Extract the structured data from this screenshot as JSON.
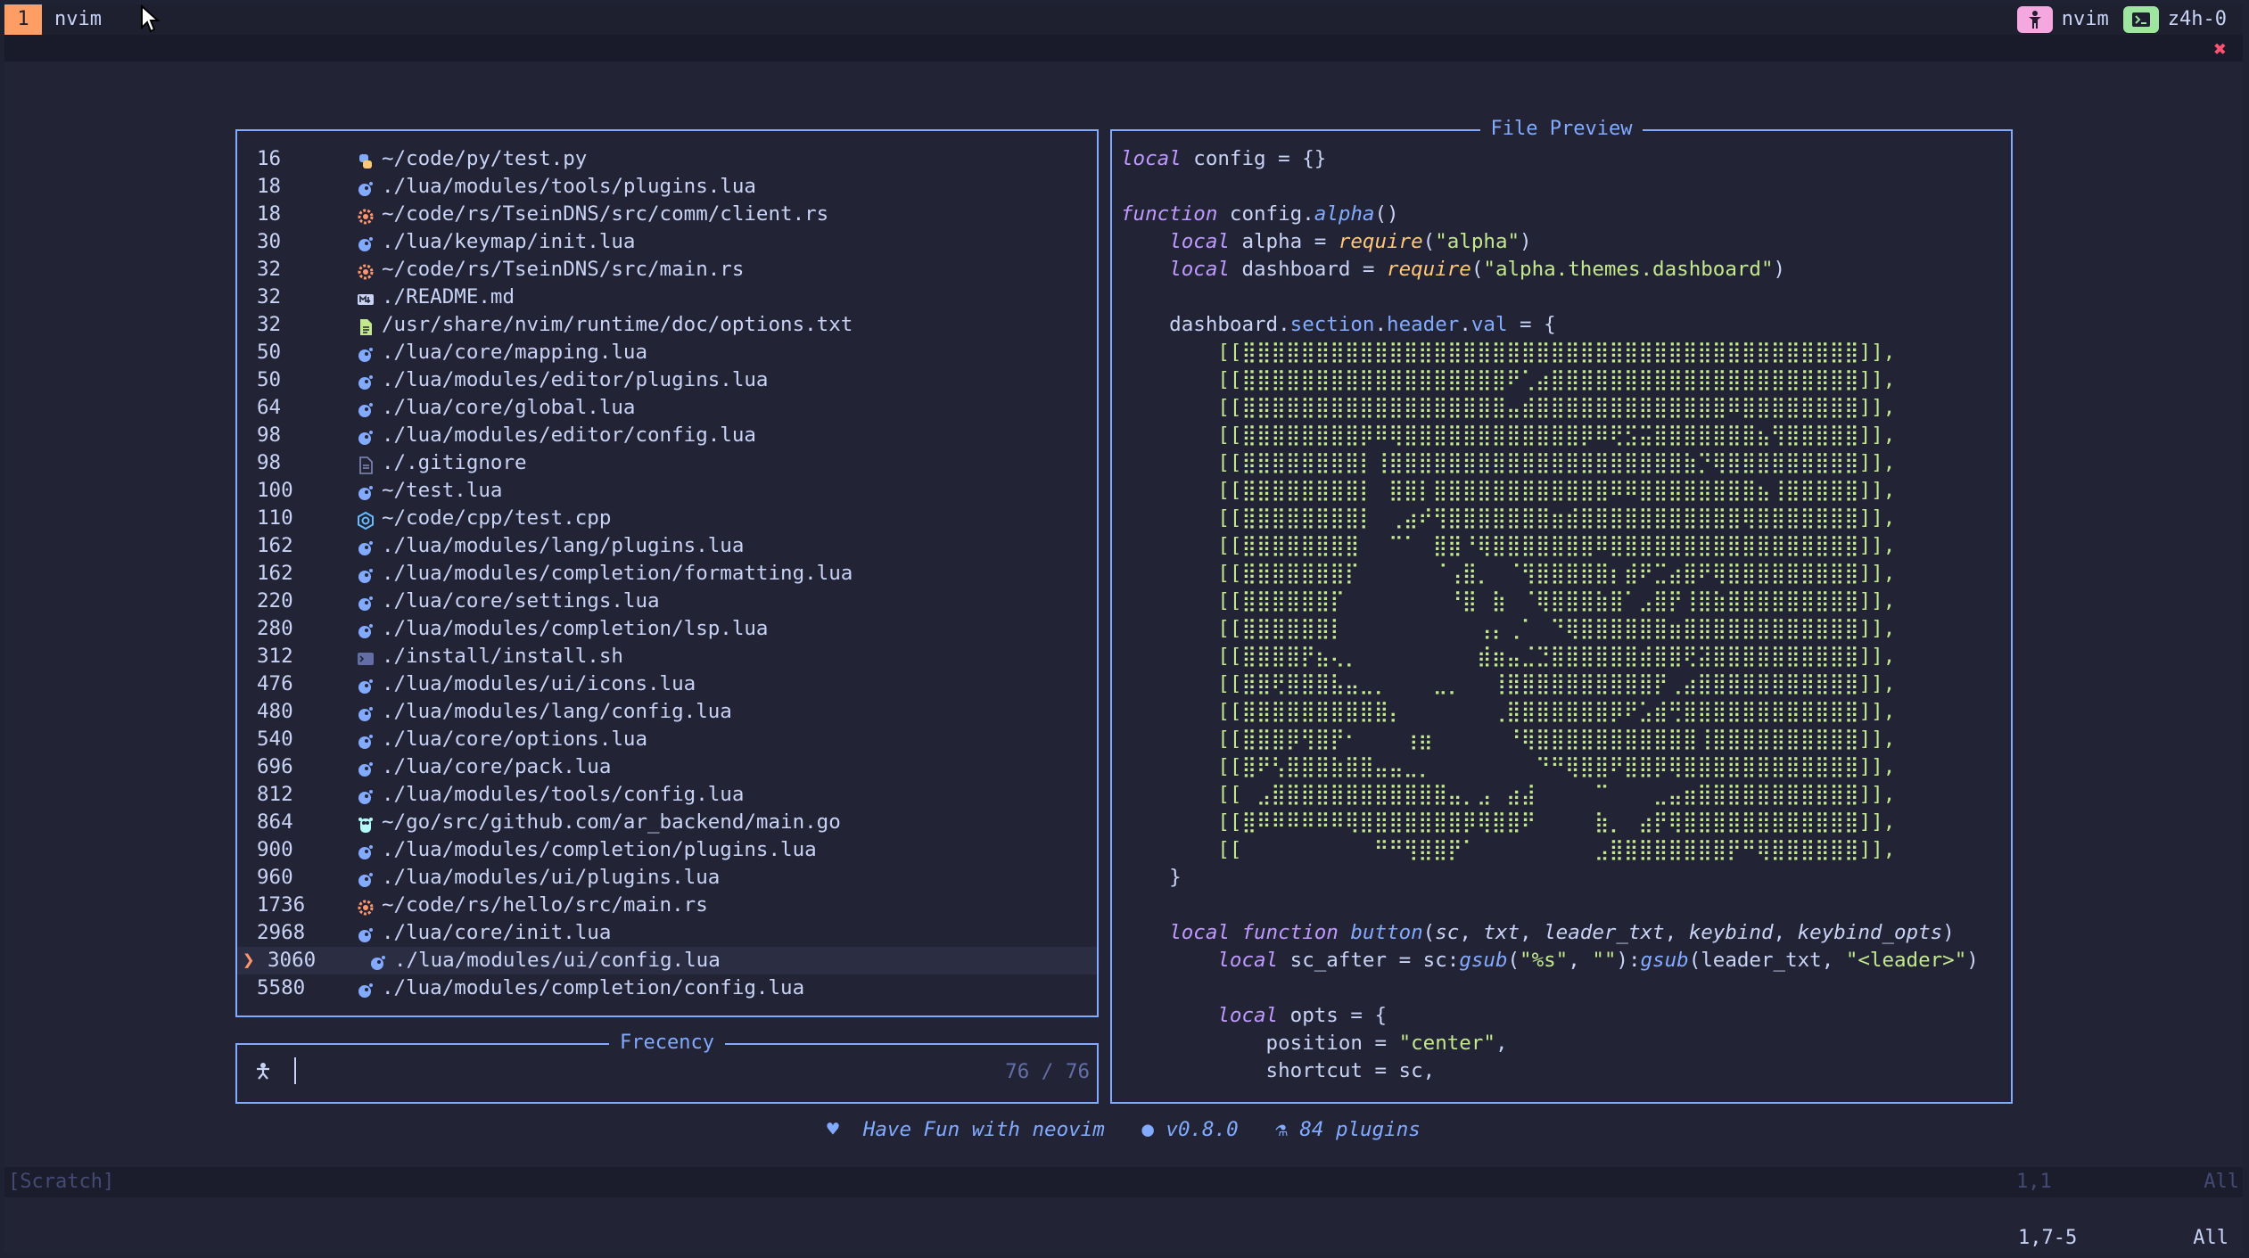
{
  "tmux": {
    "window_number": "1",
    "window_name": "nvim",
    "right_items": [
      {
        "icon": "person-icon",
        "label": "nvim",
        "color": "#f5a8e0"
      },
      {
        "icon": "terminal-icon",
        "label": "z4h-0",
        "color": "#9ee6a0"
      }
    ]
  },
  "picker": {
    "results_rows": [
      {
        "score": "16",
        "icon": "python-icon",
        "icon_color": "#ffc777",
        "path": "~/code/py/test.py"
      },
      {
        "score": "18",
        "icon": "lua-icon",
        "icon_color": "#82aaff",
        "path": "./lua/modules/tools/plugins.lua"
      },
      {
        "score": "18",
        "icon": "rust-icon",
        "icon_color": "#ff966c",
        "path": "~/code/rs/TseinDNS/src/comm/client.rs"
      },
      {
        "score": "30",
        "icon": "lua-icon",
        "icon_color": "#82aaff",
        "path": "./lua/keymap/init.lua"
      },
      {
        "score": "32",
        "icon": "rust-icon",
        "icon_color": "#ff966c",
        "path": "~/code/rs/TseinDNS/src/main.rs"
      },
      {
        "score": "32",
        "icon": "markdown-icon",
        "icon_color": "#c8d3f5",
        "path": "./README.md"
      },
      {
        "score": "32",
        "icon": "text-file-icon",
        "icon_color": "#c3e88d",
        "path": "/usr/share/nvim/runtime/doc/options.txt"
      },
      {
        "score": "50",
        "icon": "lua-icon",
        "icon_color": "#82aaff",
        "path": "./lua/core/mapping.lua"
      },
      {
        "score": "50",
        "icon": "lua-icon",
        "icon_color": "#82aaff",
        "path": "./lua/modules/editor/plugins.lua"
      },
      {
        "score": "64",
        "icon": "lua-icon",
        "icon_color": "#82aaff",
        "path": "./lua/core/global.lua"
      },
      {
        "score": "98",
        "icon": "lua-icon",
        "icon_color": "#82aaff",
        "path": "./lua/modules/editor/config.lua"
      },
      {
        "score": "98",
        "icon": "file-icon",
        "icon_color": "#828bb8",
        "path": "./.gitignore"
      },
      {
        "score": "100",
        "icon": "lua-icon",
        "icon_color": "#82aaff",
        "path": "~/test.lua"
      },
      {
        "score": "110",
        "icon": "cpp-icon",
        "icon_color": "#65bcff",
        "path": "~/code/cpp/test.cpp"
      },
      {
        "score": "162",
        "icon": "lua-icon",
        "icon_color": "#82aaff",
        "path": "./lua/modules/lang/plugins.lua"
      },
      {
        "score": "162",
        "icon": "lua-icon",
        "icon_color": "#82aaff",
        "path": "./lua/modules/completion/formatting.lua"
      },
      {
        "score": "220",
        "icon": "lua-icon",
        "icon_color": "#82aaff",
        "path": "./lua/core/settings.lua"
      },
      {
        "score": "280",
        "icon": "lua-icon",
        "icon_color": "#82aaff",
        "path": "./lua/modules/completion/lsp.lua"
      },
      {
        "score": "312",
        "icon": "shell-icon",
        "icon_color": "#636da6",
        "path": "./install/install.sh"
      },
      {
        "score": "476",
        "icon": "lua-icon",
        "icon_color": "#82aaff",
        "path": "./lua/modules/ui/icons.lua"
      },
      {
        "score": "480",
        "icon": "lua-icon",
        "icon_color": "#82aaff",
        "path": "./lua/modules/lang/config.lua"
      },
      {
        "score": "540",
        "icon": "lua-icon",
        "icon_color": "#82aaff",
        "path": "./lua/core/options.lua"
      },
      {
        "score": "696",
        "icon": "lua-icon",
        "icon_color": "#82aaff",
        "path": "./lua/core/pack.lua"
      },
      {
        "score": "812",
        "icon": "lua-icon",
        "icon_color": "#82aaff",
        "path": "./lua/modules/tools/config.lua"
      },
      {
        "score": "864",
        "icon": "go-icon",
        "icon_color": "#b4f9f8",
        "path": "~/go/src/github.com/ar_backend/main.go"
      },
      {
        "score": "900",
        "icon": "lua-icon",
        "icon_color": "#82aaff",
        "path": "./lua/modules/completion/plugins.lua"
      },
      {
        "score": "960",
        "icon": "lua-icon",
        "icon_color": "#82aaff",
        "path": "./lua/modules/ui/plugins.lua"
      },
      {
        "score": "1736",
        "icon": "rust-icon",
        "icon_color": "#ff966c",
        "path": "~/code/rs/hello/src/main.rs"
      },
      {
        "score": "2968",
        "icon": "lua-icon",
        "icon_color": "#82aaff",
        "path": "./lua/core/init.lua"
      },
      {
        "score": "3060",
        "icon": "lua-icon",
        "icon_color": "#82aaff",
        "path": "./lua/modules/ui/config.lua",
        "selected": true
      },
      {
        "score": "5580",
        "icon": "lua-icon",
        "icon_color": "#82aaff",
        "path": "./lua/modules/completion/config.lua"
      }
    ],
    "prompt_title": "Frecency",
    "prompt_value": "",
    "count": "76 / 76",
    "preview_title": "File Preview"
  },
  "preview_lines": [
    [
      {
        "c": "kw",
        "t": "local"
      },
      {
        "c": "",
        "t": " config = {}"
      }
    ],
    [],
    [
      {
        "c": "kw",
        "t": "function"
      },
      {
        "c": "",
        "t": " config."
      },
      {
        "c": "fn",
        "t": "alpha"
      },
      {
        "c": "",
        "t": "()"
      }
    ],
    [
      {
        "c": "",
        "t": "    "
      },
      {
        "c": "kw",
        "t": "local"
      },
      {
        "c": "",
        "t": " alpha = "
      },
      {
        "c": "req",
        "t": "require"
      },
      {
        "c": "",
        "t": "("
      },
      {
        "c": "str",
        "t": "\"alpha\""
      },
      {
        "c": "",
        "t": ")"
      }
    ],
    [
      {
        "c": "",
        "t": "    "
      },
      {
        "c": "kw",
        "t": "local"
      },
      {
        "c": "",
        "t": " dashboard = "
      },
      {
        "c": "req",
        "t": "require"
      },
      {
        "c": "",
        "t": "("
      },
      {
        "c": "str",
        "t": "\"alpha.themes.dashboard\""
      },
      {
        "c": "",
        "t": ")"
      }
    ],
    [],
    [
      {
        "c": "",
        "t": "    dashboard."
      },
      {
        "c": "prop",
        "t": "section"
      },
      {
        "c": "",
        "t": "."
      },
      {
        "c": "prop",
        "t": "header"
      },
      {
        "c": "",
        "t": "."
      },
      {
        "c": "prop",
        "t": "val"
      },
      {
        "c": "",
        "t": " = {"
      }
    ],
    [
      {
        "c": "",
        "t": "        "
      },
      {
        "c": "art",
        "t": "[[⣿⣿⣿⣿⣿⣿⣿⣿⣿⣿⣿⣿⣿⣿⣿⣿⣿⣿⣿⣿⣿⣿⣿⣿⣿⣿⣿⣿⣿⣿⣿⣿⣿⣿⣿⣿⣿⣿⣿⣿⣿⣿]],"
      }
    ],
    [
      {
        "c": "",
        "t": "        "
      },
      {
        "c": "art",
        "t": "[[⣿⣿⣿⣿⣿⣿⣿⣿⣿⣿⣿⣿⣿⣿⣿⣿⣿⣿⠟⢁⣴⣿⣿⣿⣿⣿⣿⣿⣿⣿⣿⣿⣿⣿⣿⣿⣿⣿⣿⣿⣿⣿]],"
      }
    ],
    [
      {
        "c": "",
        "t": "        "
      },
      {
        "c": "art",
        "t": "[[⣿⣿⣿⣿⣿⣿⣿⣿⣿⣿⣿⣿⣿⣿⣿⣿⣿⣿⣤⣾⣿⣿⣿⣿⣿⣿⣿⣿⣿⣿⣿⣿⣿⠿⣿⣿⣿⣿⣿⣿⣿⣿]],"
      }
    ],
    [
      {
        "c": "",
        "t": "        "
      },
      {
        "c": "art",
        "t": "[[⣿⣿⣿⣿⣿⣿⣿⣿⡿⠿⢿⣿⣿⣿⣿⣿⣿⣿⣿⣿⣿⣿⣿⡿⠿⢟⣫⣭⣿⣿⣿⣿⣿⣿⣿⣦⢻⣿⣿⣿⣿⣿]],"
      }
    ],
    [
      {
        "c": "",
        "t": "        "
      },
      {
        "c": "art",
        "t": "[[⣿⣿⣿⣿⣿⣿⣿⣿⡇⢸⣿⣿⣿⣿⣿⣿⣿⣿⣿⣿⣿⣿⣿⣿⣿⣿⣿⣿⣿⣿⣷⡙⢿⣿⣿⣿⣿⣿⣿⣿⣿⣿]],"
      }
    ],
    [
      {
        "c": "",
        "t": "        "
      },
      {
        "c": "art",
        "t": "[[⣿⣿⣿⣿⣿⣿⣿⣿⡇⠀⣿⣿⡇⣿⣿⣿⣿⣿⣿⣿⣿⣿⣿⣿⣿⠿⠿⣿⣿⣿⣿⣿⣿⣿⣿⣦⢸⣿⣿⣿⣿⣿]],"
      }
    ],
    [
      {
        "c": "",
        "t": "        "
      },
      {
        "c": "art",
        "t": "[[⣿⣿⣿⣿⣿⣿⣿⣿⡇⠀⢀⣴⠞⢻⣿⣿⣿⣿⣿⣿⣿⣶⣾⣿⣿⣿⣿⣿⣿⣿⣿⣿⣿⣿⢿⣿⣿⣿⣿⣿⣿⣿]],"
      }
    ],
    [
      {
        "c": "",
        "t": "        "
      },
      {
        "c": "art",
        "t": "[[⣿⣿⣿⣿⣿⣿⣿⣿⠀⠀⠉⠁⠀⣿⣿⠘⢿⣿⣿⣿⣿⣿⣿⣿⠿⣿⣿⣿⣿⣿⣿⣿⣿⣿⣿⣿⣿⣿⣿⣿⣿⣿]],"
      }
    ],
    [
      {
        "c": "",
        "t": "        "
      },
      {
        "c": "art",
        "t": "[[⣿⣿⣿⣿⣿⣿⣿⡏⠀⠀⠀⠀⠀⠈⢠⣿⡀⠀⠈⢻⣿⣿⣿⣿⣿⡆⣾⠟⣉⣴⣿⠟⢿⣿⣿⣿⣿⣿⣿⣿⣿⣿]],"
      }
    ],
    [
      {
        "c": "",
        "t": "        "
      },
      {
        "c": "art",
        "t": "[[⣿⣿⣿⣿⣿⣿⡏⠀⠀⠀⠀⠀⠀⠀⠘⣿⠀⣷⠀⠈⢿⣿⣿⣿⣷⣿⠁⣠⣿⡟⢸⣿⣷⣿⣿⣿⣿⣿⣿⣿⣿⣿]],"
      }
    ],
    [
      {
        "c": "",
        "t": "        "
      },
      {
        "c": "art",
        "t": "[[⣿⣿⣿⣿⣿⣿⡇⠀⠀⠀⠀⠀⠀⠀⠀⠀⢠⡄⢀⠁⠀⠙⢿⣿⣿⣿⣿⣿⣿⣶⣿⣿⣿⣿⣿⣿⣿⣿⣿⣿⣿⣿]],"
      }
    ],
    [
      {
        "c": "",
        "t": "        "
      },
      {
        "c": "art",
        "t": "[[⣿⣿⣿⣿⡟⣦⢄⡀⠀⠀⠀⠀⠀⠀⠀⠀⣾⣶⣤⣈⣙⣿⣿⣿⣿⣿⣿⣾⣿⣿⢟⣽⣿⣿⣿⣿⣿⣿⣿⣿⣿⣿]],"
      }
    ],
    [
      {
        "c": "",
        "t": "        "
      },
      {
        "c": "art",
        "t": "[[⣿⣿⢟⣿⣿⣿⣧⣤⣀⡀⠀⠀⠀⣀⡀⠀⠀⢸⣿⣿⣿⣿⣿⣿⣿⣿⣿⣿⡟⢀⣴⣿⣿⣿⣿⣿⣿⣿⣿⣿⣿⣿]],"
      }
    ],
    [
      {
        "c": "",
        "t": "        "
      },
      {
        "c": "art",
        "t": "[[⣿⣿⣿⣿⣿⣿⣿⣿⣿⣿⡄⠀⠀⠀⠀⠀⠀⢀⣿⣿⣿⣿⣿⣿⣿⡿⠟⣡⣾⢛⣿⣿⣿⣿⣿⣿⣿⣿⣿⣿⣿⣿]],"
      }
    ],
    [
      {
        "c": "",
        "t": "        "
      },
      {
        "c": "art",
        "t": "[[⣿⣿⣿⡿⢻⣿⡟⠂⠀⠀⠀⢰⣶⠀⠀⠀⠀⠀⠘⢿⣿⣿⣿⣿⣿⣿⣿⣿⣿⣿⣿⢸⣿⣿⣿⣿⣿⣿⣿⣿⣿⣿]],"
      }
    ],
    [
      {
        "c": "",
        "t": "        "
      },
      {
        "c": "art",
        "t": "[[⣿⠟⢣⣿⣿⣿⣷⣿⣿⣤⣤⣀⡀⠀⠀⠀⠀⠀⠀⠀⠙⠛⢿⣿⣿⠟⣿⣿⡿⢿⣿⣿⣿⣿⣿⣿⣿⣿⣿⣿⣿⣿]],"
      }
    ],
    [
      {
        "c": "",
        "t": "        "
      },
      {
        "c": "art",
        "t": "[[⠀⣠⣿⣿⣿⣿⣿⣿⣿⣿⣿⣿⣿⣿⣤⡀⣠⠀⣴⣼⠀⠀⠀⠀⠉⠀⠀⠀⣀⣤⣶⣿⣿⣿⣿⣿⣿⣿⣿⣿⣿⣿]],"
      }
    ],
    [
      {
        "c": "",
        "t": "        "
      },
      {
        "c": "art",
        "t": "[[⣿⠿⠿⠿⠿⠿⠿⢿⣿⣿⣿⣿⣿⣿⣿⡿⢿⣿⣿⠟⠀⠀⠀⠀⣷⡀⠀⣴⡟⢿⣿⣿⣿⣿⣿⣿⣿⣿⣿⣿⣿⣿]],"
      }
    ],
    [
      {
        "c": "",
        "t": "        "
      },
      {
        "c": "art",
        "t": "[[⠀⠀⠀⠀⠀⠀⠀⠀⠀⠛⠛⢻⣿⣿⡟⠁⠀⠀⠀⠀⠀⠀⠀⠀⣠⣿⣿⣿⣿⣿⣿⣿⣿⡟⠛⢿⣿⣿⣿⣿⣿⣿]],"
      }
    ],
    [
      {
        "c": "",
        "t": "    }"
      }
    ],
    [],
    [
      {
        "c": "",
        "t": "    "
      },
      {
        "c": "kw",
        "t": "local function"
      },
      {
        "c": "",
        "t": " "
      },
      {
        "c": "fn",
        "t": "button"
      },
      {
        "c": "",
        "t": "("
      },
      {
        "c": "par",
        "t": "sc"
      },
      {
        "c": "",
        "t": ", "
      },
      {
        "c": "par",
        "t": "txt"
      },
      {
        "c": "",
        "t": ", "
      },
      {
        "c": "par",
        "t": "leader_txt"
      },
      {
        "c": "",
        "t": ", "
      },
      {
        "c": "par",
        "t": "keybind"
      },
      {
        "c": "",
        "t": ", "
      },
      {
        "c": "par",
        "t": "keybind_opts"
      },
      {
        "c": "",
        "t": ")"
      }
    ],
    [
      {
        "c": "",
        "t": "        "
      },
      {
        "c": "kw",
        "t": "local"
      },
      {
        "c": "",
        "t": " sc_after = sc:"
      },
      {
        "c": "fn",
        "t": "gsub"
      },
      {
        "c": "",
        "t": "("
      },
      {
        "c": "str",
        "t": "\"%s\""
      },
      {
        "c": "",
        "t": ", "
      },
      {
        "c": "str",
        "t": "\"\""
      },
      {
        "c": "",
        "t": "):"
      },
      {
        "c": "fn",
        "t": "gsub"
      },
      {
        "c": "",
        "t": "(leader_txt, "
      },
      {
        "c": "str",
        "t": "\"<leader>\""
      },
      {
        "c": "",
        "t": ")"
      }
    ],
    [],
    [
      {
        "c": "",
        "t": "        "
      },
      {
        "c": "kw",
        "t": "local"
      },
      {
        "c": "",
        "t": " opts = {"
      }
    ],
    [
      {
        "c": "",
        "t": "            position = "
      },
      {
        "c": "str",
        "t": "\"center\""
      },
      {
        "c": "",
        "t": ","
      }
    ],
    [
      {
        "c": "",
        "t": "            shortcut = sc,"
      }
    ]
  ],
  "footer": {
    "message": "Have Fun with neovim",
    "version": "v0.8.0",
    "plugins": "84 plugins"
  },
  "statusline": {
    "buffer": "[Scratch]",
    "position": "1,1",
    "scroll": "All"
  },
  "cmdline": {
    "position": "1,7-5",
    "scroll": "All"
  },
  "colors": {
    "border": "#82aaff",
    "accent": "#ff9e64",
    "background": "#222436"
  }
}
